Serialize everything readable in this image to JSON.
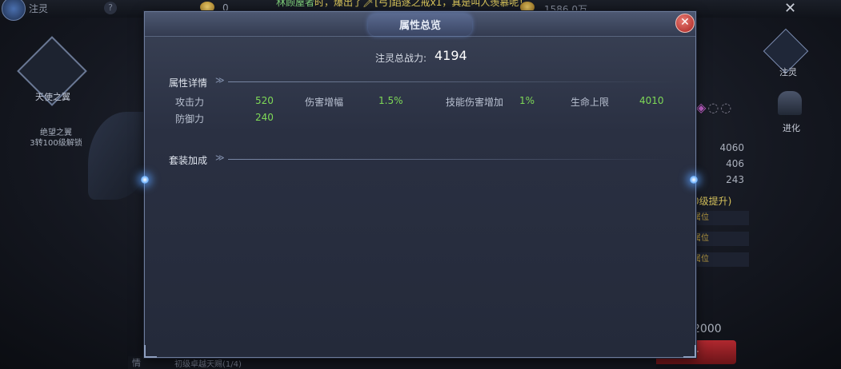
{
  "topbar": {
    "left_label": "注灵",
    "help_glyph": "?",
    "coin_value": "0",
    "ticker_name": "林顾屋者",
    "ticker_text": "时，爆出了🗡[弓]蹈逐之戒x1，真是叫人羡慕呢！",
    "gold_value": "1586.0万",
    "close_glyph": "✕"
  },
  "left_panel": {
    "emblem_label": "天使之翼",
    "locked_label": "绝望之翼\n3转100级解锁"
  },
  "right_panel": {
    "tab_1": "注灵",
    "tab_2": "进化",
    "stats": [
      "4060",
      "406",
      "243"
    ],
    "upgrade_note": "0级提升)",
    "row_labels": [
      "属位",
      "属位",
      "属位"
    ],
    "cost": "2000",
    "red_button": "升"
  },
  "bottom": {
    "left_char": "情",
    "label": "初级卓越天赐(1/4)"
  },
  "dialog": {
    "title": "属性总览",
    "close_glyph": "✕",
    "power_label": "注灵总战力:",
    "power_value": "4194",
    "sections": {
      "details": "属性详情",
      "set_bonus": "套装加成"
    },
    "attributes": [
      {
        "label": "攻击力",
        "value": "520"
      },
      {
        "label": "伤害增幅",
        "value": "1.5%"
      },
      {
        "label": "技能伤害增加",
        "value": "1%"
      },
      {
        "label": "生命上限",
        "value": "4010"
      },
      {
        "label": "防御力",
        "value": "240"
      }
    ]
  },
  "colors": {
    "value_green": "#7ed957",
    "close_red": "#c0302a",
    "accent_blue": "#6fb2ff"
  }
}
